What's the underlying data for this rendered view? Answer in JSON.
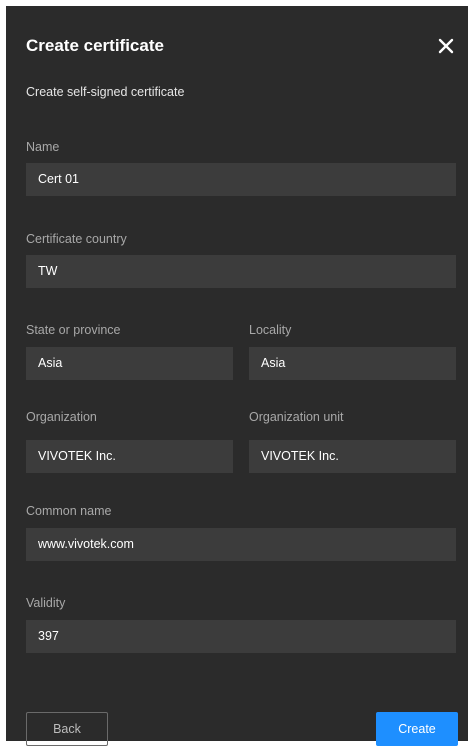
{
  "dialog": {
    "title": "Create certificate",
    "subtitle": "Create self-signed certificate"
  },
  "fields": {
    "name": {
      "label": "Name",
      "value": "Cert 01"
    },
    "country": {
      "label": "Certificate country",
      "value": "TW"
    },
    "state": {
      "label": "State or province",
      "value": "Asia"
    },
    "locality": {
      "label": "Locality",
      "value": "Asia"
    },
    "organization": {
      "label": "Organization",
      "value": "VIVOTEK Inc."
    },
    "org_unit": {
      "label": "Organization unit",
      "value": "VIVOTEK Inc."
    },
    "common_name": {
      "label": "Common name",
      "value": "www.vivotek.com"
    },
    "validity": {
      "label": "Validity",
      "value": "397"
    }
  },
  "buttons": {
    "back": "Back",
    "create": "Create"
  },
  "colors": {
    "dialog_bg": "#2b2b2b",
    "field_bg": "#3c3c3c",
    "accent": "#1e8fff"
  },
  "icons": {
    "close": "close-icon"
  }
}
